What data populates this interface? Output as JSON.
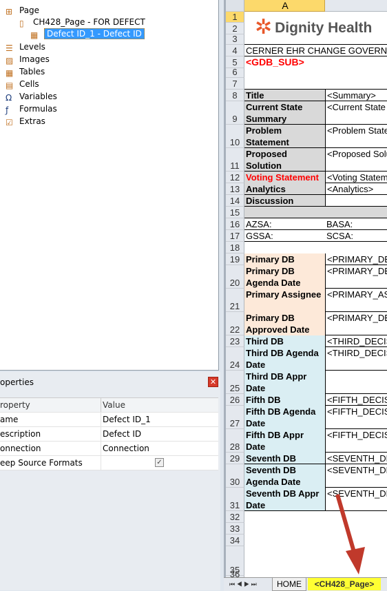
{
  "tree": {
    "items": [
      {
        "label": "Page",
        "icon": "page-plus-icon"
      },
      {
        "label": "CH428_Page - FOR DEFECT",
        "icon": "document-icon"
      },
      {
        "label": "Defect ID_1 - Defect ID",
        "icon": "table-icon",
        "selected": true
      },
      {
        "label": "Levels",
        "icon": "levels-icon"
      },
      {
        "label": "Images",
        "icon": "image-icon"
      },
      {
        "label": "Tables",
        "icon": "table-icon"
      },
      {
        "label": "Cells",
        "icon": "cells-icon"
      },
      {
        "label": "Variables",
        "icon": "omega-icon"
      },
      {
        "label": "Formulas",
        "icon": "fx-icon"
      },
      {
        "label": "Extras",
        "icon": "checklist-icon"
      }
    ]
  },
  "properties": {
    "title": "operties",
    "header": {
      "property": "roperty",
      "value": "Value"
    },
    "rows": [
      {
        "property": "ame",
        "value": "Defect ID_1"
      },
      {
        "property": "escription",
        "value": "Defect ID"
      },
      {
        "property": "onnection",
        "value": "Connection"
      },
      {
        "property": "eep Source Formats",
        "value": "",
        "checked": true
      }
    ]
  },
  "sheet": {
    "column_header": "A",
    "logo_text": "Dignity Health",
    "colors": {
      "label_gray": "#d9d9d9",
      "primary": "#fde9d9",
      "secondary": "#daeef3",
      "red": "#ff0000",
      "logo": "#e8582a"
    },
    "rows": [
      {
        "n": "1"
      },
      {
        "n": "2"
      },
      {
        "n": "3"
      },
      {
        "n": "4",
        "a": "CERNER EHR CHANGE GOVERNANCE",
        "style": "title"
      },
      {
        "n": "5",
        "a": "<GDB_SUB>",
        "style": "red-title"
      },
      {
        "n": "6"
      },
      {
        "n": "7"
      },
      {
        "n": "8",
        "a": "Title",
        "b": "<Summary>",
        "style": "gray"
      },
      {
        "n": "9",
        "a": "Current State Summary",
        "b": "<Current State",
        "style": "gray"
      },
      {
        "n": "10",
        "a": "Problem Statement",
        "b": "<Problem Statement",
        "style": "gray"
      },
      {
        "n": "11",
        "a": "Proposed Solution",
        "b": "<Proposed Solution",
        "style": "gray"
      },
      {
        "n": "12",
        "a": "Voting Statement",
        "b": "<Voting Statement",
        "style": "gray-red"
      },
      {
        "n": "13",
        "a": "Analytics",
        "b": "<Analytics>",
        "style": "gray"
      },
      {
        "n": "14",
        "a": "Discussion",
        "b": "",
        "style": "gray"
      },
      {
        "n": "15",
        "style": "gray-full"
      },
      {
        "n": "16",
        "a": "AZSA:",
        "b": "BASA:",
        "style": "plain"
      },
      {
        "n": "17",
        "a": "GSSA:",
        "b": "SCSA:",
        "style": "plain"
      },
      {
        "n": "18"
      },
      {
        "n": "19",
        "a": "Primary DB",
        "b": "<PRIMARY_DB",
        "style": "primary"
      },
      {
        "n": "20",
        "a": "Primary DB Agenda Date",
        "b": "<PRIMARY_DB",
        "style": "primary"
      },
      {
        "n": "21",
        "a": "Primary Assignee",
        "b": "<PRIMARY_AS",
        "style": "primary"
      },
      {
        "n": "22",
        "a": "Primary DB Approved Date",
        "b": "<PRIMARY_DB",
        "style": "primary"
      },
      {
        "n": "23",
        "a": "Third DB",
        "b": "<THIRD_DECIS",
        "style": "secondary"
      },
      {
        "n": "24",
        "a": "Third DB Agenda Date",
        "b": "<THIRD_DECIS",
        "style": "secondary"
      },
      {
        "n": "25",
        "a": "Third DB Appr Date",
        "b": "",
        "style": "secondary"
      },
      {
        "n": "26",
        "a": "Fifth DB",
        "b": "<FIFTH_DECIS",
        "style": "secondary"
      },
      {
        "n": "27",
        "a": "Fifth DB Agenda Date",
        "b": "<FIFTH_DECIS",
        "style": "secondary"
      },
      {
        "n": "28",
        "a": "Fifth DB Appr Date",
        "b": "<FIFTH_DECIS",
        "style": "secondary"
      },
      {
        "n": "29",
        "a": "Seventh DB",
        "b": "<SEVENTH_DE",
        "style": "secondary"
      },
      {
        "n": "30",
        "a": "Seventh DB Agenda Date",
        "b": "<SEVENTH_DE",
        "style": "secondary"
      },
      {
        "n": "31",
        "a": "Seventh DB Appr Date",
        "b": "<SEVENTH_DE",
        "style": "secondary"
      },
      {
        "n": "32"
      },
      {
        "n": "33"
      },
      {
        "n": "34"
      },
      {
        "n": "35"
      },
      {
        "n": "36"
      }
    ],
    "tabs": [
      {
        "label": "HOME"
      },
      {
        "label": "<CH428_Page>",
        "active": true,
        "highlight": "#ffff33"
      }
    ]
  },
  "annotation": {
    "arrow_color": "#c0392b"
  }
}
